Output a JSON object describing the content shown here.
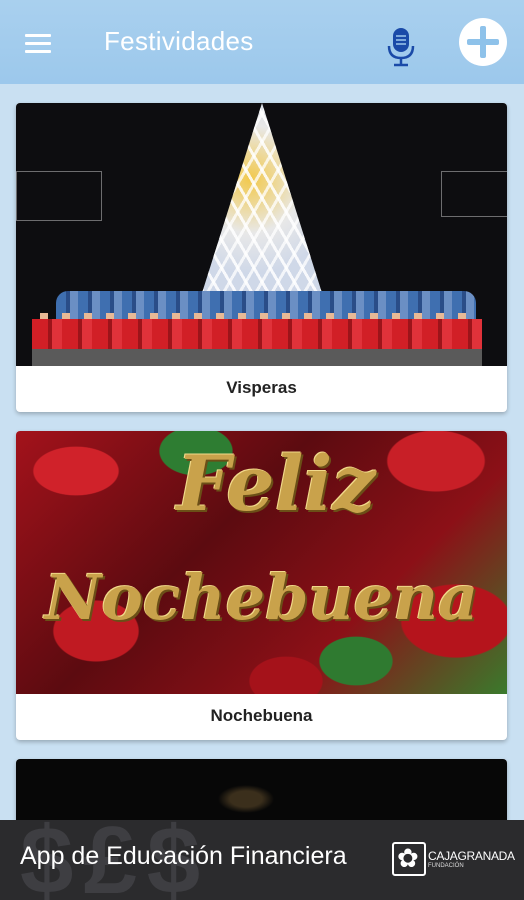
{
  "appbar": {
    "title": "Festividades",
    "menu_icon": "menu-icon",
    "mic_icon": "microphone-icon",
    "add_icon": "add-icon",
    "color": "#9cc8ec"
  },
  "cards": [
    {
      "label": "Visperas"
    },
    {
      "label": "Nochebuena",
      "image_text_line1": "Feliz",
      "image_text_line2": "Nochebuena"
    },
    {
      "label": ""
    }
  ],
  "banner": {
    "text": "App de Educación Financiera",
    "logo_name": "CAJAGRANADA",
    "logo_sub": "FUNDACIÓN"
  }
}
